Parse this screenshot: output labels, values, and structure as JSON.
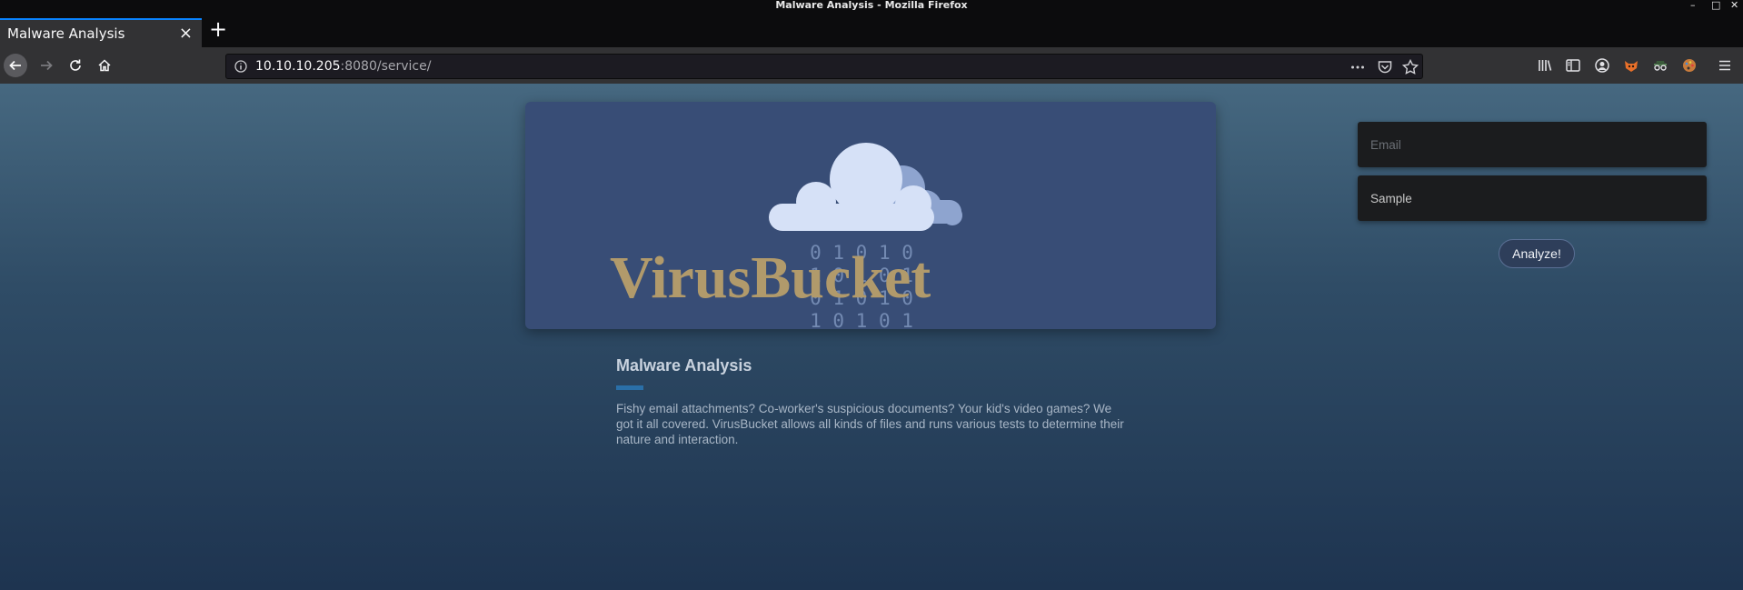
{
  "window": {
    "title": "Malware Analysis - Mozilla Firefox",
    "controls": [
      "–",
      "□",
      "✕"
    ]
  },
  "tab": {
    "label": "Malware Analysis",
    "close": "×",
    "new_tab": "+"
  },
  "navbar": {
    "url_host": "10.10.10.205",
    "url_rest": ":8080/service/",
    "icons": [
      "back-arrow-icon",
      "forward-arrow-icon",
      "reload-icon",
      "home-icon",
      "site-info-icon",
      "page-actions-icon",
      "pocket-icon",
      "bookmark-star-icon",
      "library-icon",
      "sidebar-icon",
      "account-icon",
      "extension-foxyproxy-icon",
      "extension-spy-icon",
      "extension-palette-icon",
      "menu-icon"
    ]
  },
  "hero": {
    "brand": "VirusBucket",
    "binary_rows": [
      "0 1 0 1 0",
      "1 0 1 0 1",
      "0 1 0 1 0",
      "1 0 1 0 1"
    ]
  },
  "content": {
    "title": "Malware Analysis",
    "description": "Fishy email attachments? Co-worker's suspicious documents? Your kid's video games? We got it all covered. VirusBucket allows all kinds of files and runs various tests to determine their nature and interaction."
  },
  "form": {
    "email_placeholder": "Email",
    "sample_label": "Sample",
    "submit_label": "Analyze!"
  },
  "colors": {
    "accent": "#0a84ff",
    "brand_gold": "#b19a6b",
    "hero_bg": "#384d76"
  }
}
